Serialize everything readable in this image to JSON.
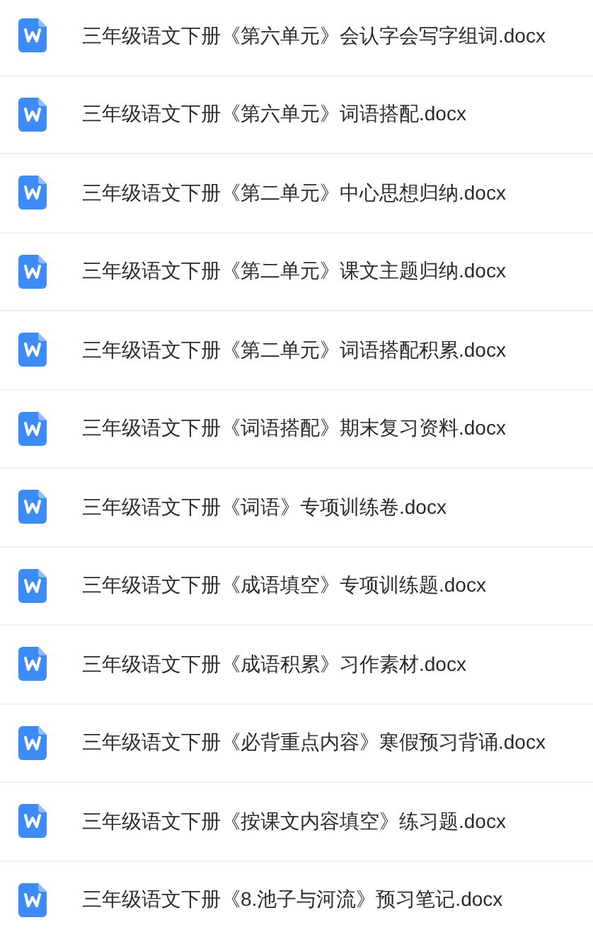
{
  "files": [
    {
      "name": "三年级语文下册《第六单元》会认字会写字组词.docx"
    },
    {
      "name": "三年级语文下册《第六单元》词语搭配.docx"
    },
    {
      "name": "三年级语文下册《第二单元》中心思想归纳.docx"
    },
    {
      "name": "三年级语文下册《第二单元》课文主题归纳.docx"
    },
    {
      "name": "三年级语文下册《第二单元》词语搭配积累.docx"
    },
    {
      "name": "三年级语文下册《词语搭配》期末复习资料.docx"
    },
    {
      "name": "三年级语文下册《词语》专项训练卷.docx"
    },
    {
      "name": "三年级语文下册《成语填空》专项训练题.docx"
    },
    {
      "name": "三年级语文下册《成语积累》习作素材.docx"
    },
    {
      "name": "三年级语文下册《必背重点内容》寒假预习背诵.docx"
    },
    {
      "name": "三年级语文下册《按课文内容填空》练习题.docx"
    },
    {
      "name": "三年级语文下册《8.池子与河流》预习笔记.docx"
    }
  ]
}
